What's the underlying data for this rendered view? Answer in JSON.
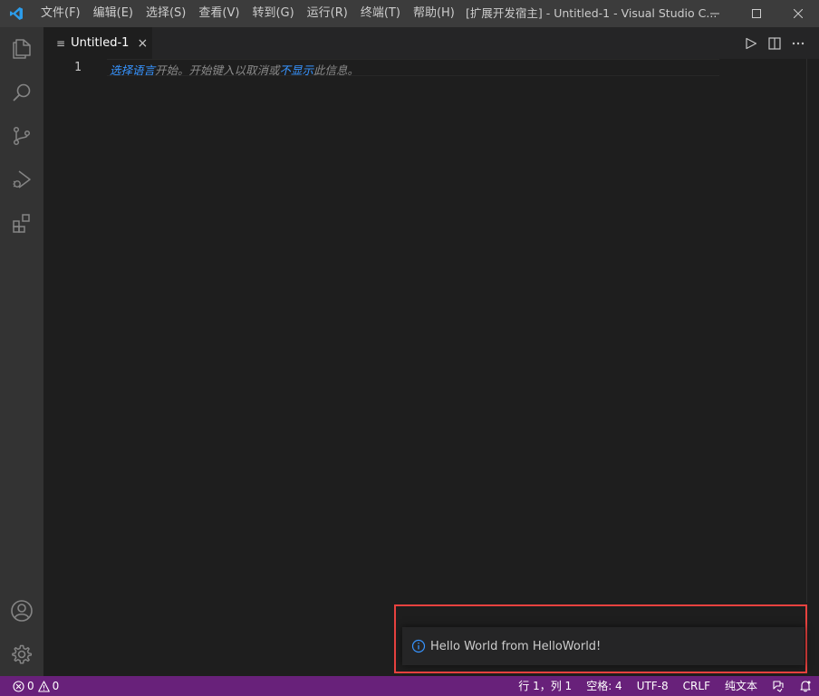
{
  "titlebar": {
    "menu": [
      "文件(F)",
      "编辑(E)",
      "选择(S)",
      "查看(V)",
      "转到(G)",
      "运行(R)",
      "终端(T)",
      "帮助(H)"
    ],
    "window_title": "[扩展开发宿主] - Untitled-1 - Visual Studio C..."
  },
  "activitybar": {
    "icons": [
      "explorer-icon",
      "search-icon",
      "source-control-icon",
      "run-debug-icon",
      "extensions-icon",
      "account-icon",
      "settings-gear-icon"
    ]
  },
  "editor": {
    "tab": {
      "label": "Untitled-1",
      "close": "×"
    },
    "line_number": "1",
    "hint": {
      "part1": "选择语言",
      "part2": "开始。开始键入以取消或",
      "part3": "不显示",
      "part4": "此信息。"
    }
  },
  "notification": {
    "message": "Hello World from HelloWorld!"
  },
  "statusbar": {
    "errors": "0",
    "warnings": "0",
    "position": "行 1，列 1",
    "spaces": "空格: 4",
    "encoding": "UTF-8",
    "eol": "CRLF",
    "language": "纯文本"
  },
  "colors": {
    "accent": "#68217a",
    "link": "#3794ff",
    "highlight_border": "#e8423f"
  }
}
